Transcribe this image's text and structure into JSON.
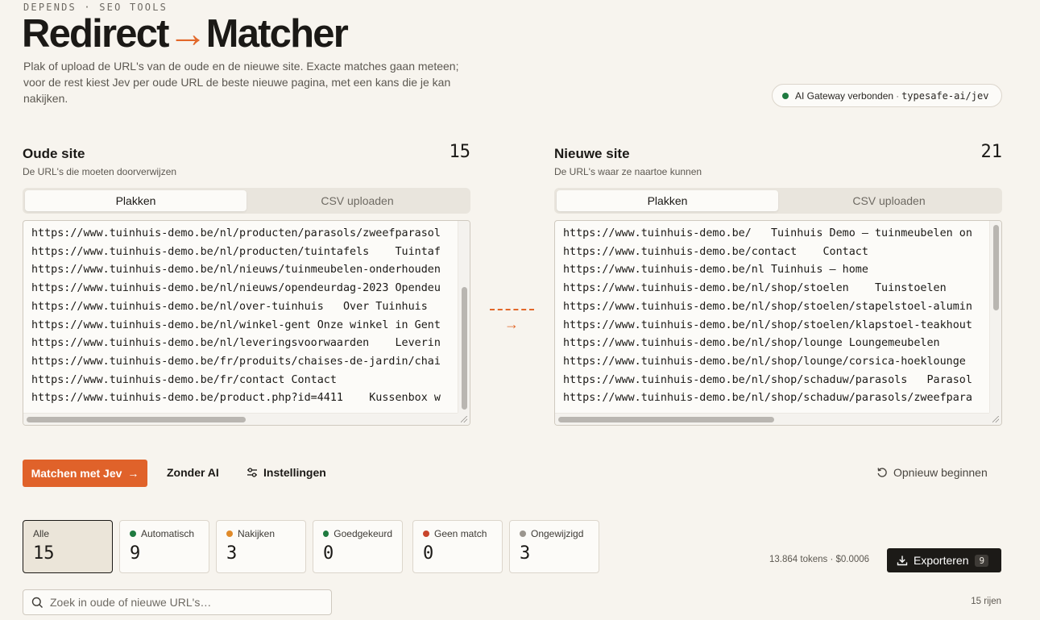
{
  "header": {
    "eyebrow": "DEPENDS · SEO TOOLS",
    "title_left": "Redirect",
    "title_arrow": "→",
    "title_right": "Matcher",
    "intro": "Plak of upload de URL's van de oude en de nieuwe site. Exacte matches gaan meteen; voor de rest kiest Jev per oude URL de beste nieuwe pagina, met een kans die je kan nakijken."
  },
  "gateway": {
    "label": "AI Gateway verbonden",
    "separator": "·",
    "model": "typesafe-ai/jev",
    "status_color": "#1f7a3f"
  },
  "old_site": {
    "title": "Oude site",
    "subtitle": "De URL's die moeten doorverwijzen",
    "count": "15",
    "tab_paste": "Plakken",
    "tab_csv": "CSV uploaden",
    "lines": [
      "https://www.tuinhuis-demo.be/nl/producten/parasols/zweefparasol",
      "https://www.tuinhuis-demo.be/nl/producten/tuintafels    Tuintaf",
      "https://www.tuinhuis-demo.be/nl/nieuws/tuinmeubelen-onderhouden",
      "https://www.tuinhuis-demo.be/nl/nieuws/opendeurdag-2023 Opendeu",
      "https://www.tuinhuis-demo.be/nl/over-tuinhuis   Over Tuinhuis",
      "https://www.tuinhuis-demo.be/nl/winkel-gent Onze winkel in Gent",
      "https://www.tuinhuis-demo.be/nl/leveringsvoorwaarden    Leverin",
      "https://www.tuinhuis-demo.be/fr/produits/chaises-de-jardin/chai",
      "https://www.tuinhuis-demo.be/fr/contact Contact",
      "https://www.tuinhuis-demo.be/product.php?id=4411    Kussenbox w"
    ]
  },
  "new_site": {
    "title": "Nieuwe site",
    "subtitle": "De URL's waar ze naartoe kunnen",
    "count": "21",
    "tab_paste": "Plakken",
    "tab_csv": "CSV uploaden",
    "lines": [
      "https://www.tuinhuis-demo.be/   Tuinhuis Demo — tuinmeubelen on",
      "https://www.tuinhuis-demo.be/contact    Contact",
      "https://www.tuinhuis-demo.be/nl Tuinhuis — home",
      "https://www.tuinhuis-demo.be/nl/shop/stoelen    Tuinstoelen",
      "https://www.tuinhuis-demo.be/nl/shop/stoelen/stapelstoel-alumin",
      "https://www.tuinhuis-demo.be/nl/shop/stoelen/klapstoel-teakhout",
      "https://www.tuinhuis-demo.be/nl/shop/lounge Loungemeubelen",
      "https://www.tuinhuis-demo.be/nl/shop/lounge/corsica-hoeklounge",
      "https://www.tuinhuis-demo.be/nl/shop/schaduw/parasols   Parasol",
      "https://www.tuinhuis-demo.be/nl/shop/schaduw/parasols/zweefpara"
    ]
  },
  "actions": {
    "match": "Matchen met Jev",
    "match_icon": "→",
    "no_ai": "Zonder AI",
    "settings": "Instellingen",
    "reset": "Opnieuw beginnen"
  },
  "stats": [
    {
      "label": "Alle",
      "value": "15",
      "color": ""
    },
    {
      "label": "Automatisch",
      "value": "9",
      "color": "#1f7a3f"
    },
    {
      "label": "Nakijken",
      "value": "3",
      "color": "#e08a2a"
    },
    {
      "label": "Goedgekeurd",
      "value": "0",
      "color": "#1f7a3f"
    },
    {
      "label": "Geen match",
      "value": "0",
      "color": "#c8452b"
    },
    {
      "label": "Ongewijzigd",
      "value": "3",
      "color": "#9a958d"
    }
  ],
  "usage": "13.864 tokens · $0.0006",
  "export": {
    "label": "Exporteren",
    "badge": "9"
  },
  "search": {
    "placeholder": "Zoek in oude of nieuwe URL's…"
  },
  "rows": "15 rijen"
}
